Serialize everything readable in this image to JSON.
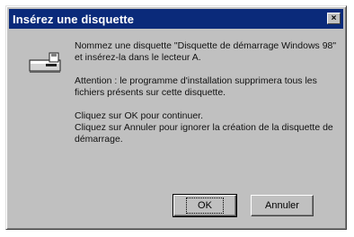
{
  "window": {
    "title": "Insérez une disquette",
    "close_symbol": "×"
  },
  "message": {
    "line1": "Nommez une disquette \"Disquette de démarrage Windows 98\" et insérez-la dans le lecteur A.",
    "line2": "Attention : le programme d'installation supprimera tous les fichiers présents sur cette disquette.",
    "line3": "Cliquez sur OK pour continuer.",
    "line4": "Cliquez sur Annuler pour ignorer la création de la disquette de démarrage."
  },
  "buttons": {
    "ok": "OK",
    "cancel": "Annuler"
  },
  "icon": "floppy-drive-icon",
  "colors": {
    "titlebar": "#0a2a7a",
    "face": "#c0c0c0"
  }
}
